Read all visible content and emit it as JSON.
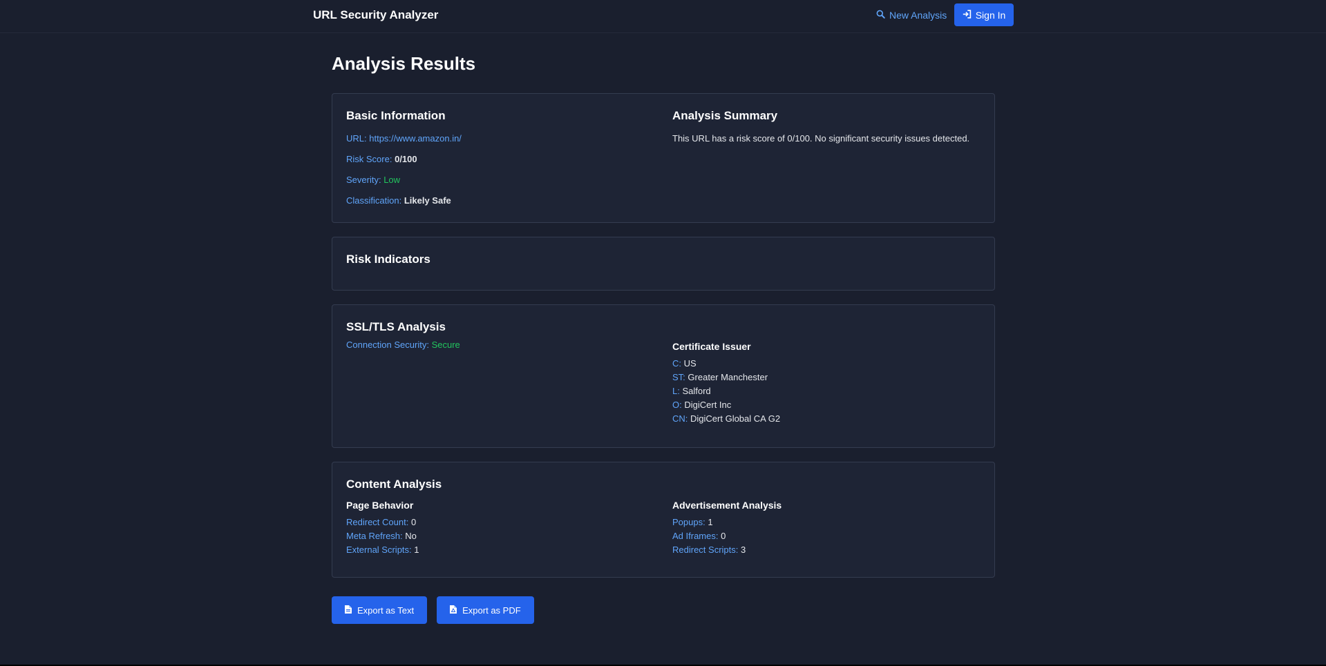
{
  "nav": {
    "brand": "URL Security Analyzer",
    "new_analysis": "New Analysis",
    "sign_in": "Sign In"
  },
  "page": {
    "title": "Analysis Results"
  },
  "basic": {
    "title": "Basic Information",
    "url_label": "URL:",
    "url_value": "https://www.amazon.in/",
    "risk_label": "Risk Score:",
    "risk_value": "0/100",
    "severity_label": "Severity:",
    "severity_value": "Low",
    "class_label": "Classification:",
    "class_value": "Likely Safe"
  },
  "summary": {
    "title": "Analysis Summary",
    "text": "This URL has a risk score of 0/100. No significant security issues detected."
  },
  "risk_indicators": {
    "title": "Risk Indicators"
  },
  "ssl": {
    "title": "SSL/TLS Analysis",
    "conn_label": "Connection Security:",
    "conn_value": "Secure",
    "issuer_title": "Certificate Issuer",
    "issuer": [
      {
        "k": "C:",
        "v": "US"
      },
      {
        "k": "ST:",
        "v": "Greater Manchester"
      },
      {
        "k": "L:",
        "v": "Salford"
      },
      {
        "k": "O:",
        "v": "DigiCert Inc"
      },
      {
        "k": "CN:",
        "v": "DigiCert Global CA G2"
      }
    ]
  },
  "content": {
    "title": "Content Analysis",
    "page_behavior": {
      "title": "Page Behavior",
      "items": [
        {
          "k": "Redirect Count:",
          "v": "0"
        },
        {
          "k": "Meta Refresh:",
          "v": "No"
        },
        {
          "k": "External Scripts:",
          "v": "1"
        }
      ]
    },
    "ads": {
      "title": "Advertisement Analysis",
      "items": [
        {
          "k": "Popups:",
          "v": "1"
        },
        {
          "k": "Ad Iframes:",
          "v": "0"
        },
        {
          "k": "Redirect Scripts:",
          "v": "3"
        }
      ]
    }
  },
  "actions": {
    "export_text": "Export as Text",
    "export_pdf": "Export as PDF"
  },
  "colors": {
    "background": "#1a1f2e",
    "card": "#1e2435",
    "accent": "#2563eb",
    "link": "#60a5fa",
    "success": "#22c55e"
  },
  "icons": {
    "new_analysis": "search-icon",
    "sign_in": "sign-in-icon",
    "export_text": "file-text-icon",
    "export_pdf": "file-pdf-icon"
  }
}
